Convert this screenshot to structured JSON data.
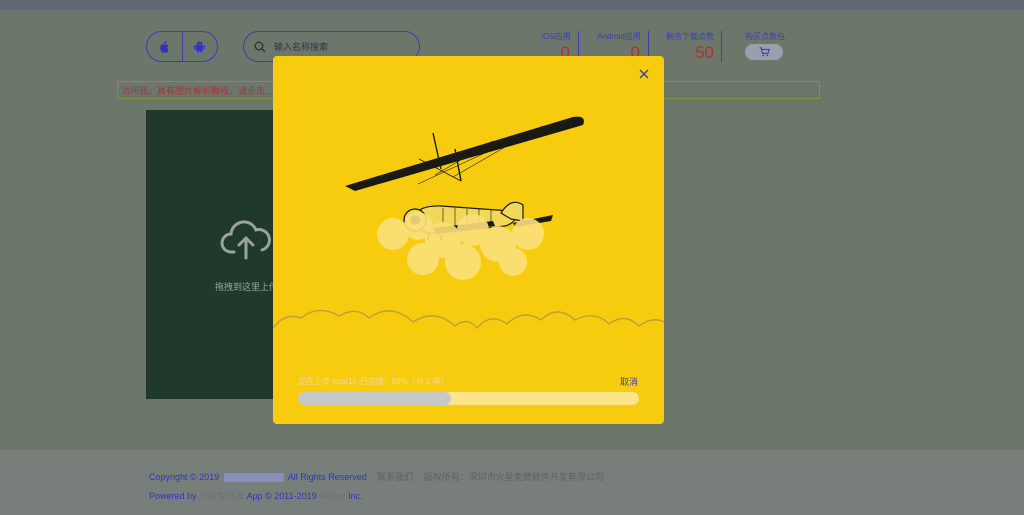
{
  "header": {
    "search_placeholder": "输入名称搜索",
    "stats": [
      {
        "label": "iOS应用",
        "value": "0"
      },
      {
        "label": "Android应用",
        "value": "0"
      },
      {
        "label": "剩余下载点数",
        "value": "50"
      }
    ],
    "buy_label": "购买点数包",
    "icons": [
      "apple-icon",
      "android-icon",
      "search-icon",
      "cart-icon"
    ]
  },
  "notice": {
    "text": "访问我，具有图片解析教程，请点击..."
  },
  "upload": {
    "hint": "拖拽到这里上传"
  },
  "modal": {
    "status_text": "正在上传 app(1), 已完成：69%（共 1 项）",
    "cancel_label": "取消",
    "progress": 0.45,
    "accent": "#f8cc0e"
  },
  "footer": {
    "line1_prefix": "Copyright © 2019",
    "line1_suffix": "All Rights Reserved",
    "contact": "联系我们",
    "rights": "版权所有：深圳市火星免费软件开发有限公司",
    "powered_prefix": "Powered by",
    "powered_brand": "火星免分发",
    "powered_mid": "App © 2011-2019",
    "powered_co": "FirDev",
    "powered_suffix": "Inc."
  }
}
